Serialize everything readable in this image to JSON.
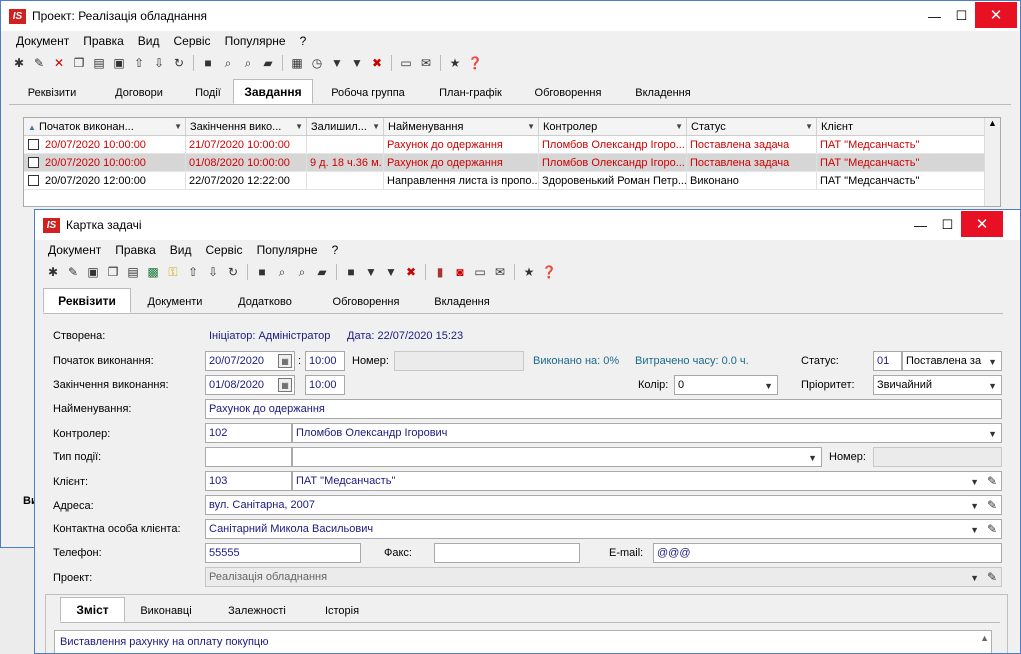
{
  "main_window": {
    "title": "Проект: Реалізація обладнання",
    "logo": "IS",
    "menu": [
      "Документ",
      "Правка",
      "Вид",
      "Сервіс",
      "Популярне",
      "?"
    ],
    "tabs": [
      "Реквізити",
      "Договори",
      "Події",
      "Завдання",
      "Робоча группа",
      "План-графік",
      "Обговорення",
      "Вкладення"
    ],
    "active_tab": "Завдання",
    "grid": {
      "columns": [
        "Початок виконан...",
        "Закінчення вико...",
        "Залишил...",
        "Найменування",
        "Контролер",
        "Статус",
        "Клієнт"
      ],
      "rows": [
        {
          "start": "20/07/2020 10:00:00",
          "end": "21/07/2020 10:00:00",
          "left": "",
          "name": "Рахунок до одержання",
          "controller": "Пломбов Олександр Ігоро...",
          "status": "Поставлена задача",
          "client": "ПАТ \"Медсанчасть\"",
          "red": true,
          "selected": false
        },
        {
          "start": "20/07/2020 10:00:00",
          "end": "01/08/2020 10:00:00",
          "left": "9 д. 18 ч.36 м.",
          "name": "Рахунок до одержання",
          "controller": "Пломбов Олександр Ігоро...",
          "status": "Поставлена задача",
          "client": "ПАТ \"Медсанчасть\"",
          "red": true,
          "selected": true
        },
        {
          "start": "20/07/2020 12:00:00",
          "end": "22/07/2020 12:22:00",
          "left": "",
          "name": "Направлення листа із пропо...",
          "controller": "Здоровенький Роман Петр...",
          "status": "Виконано",
          "client": "ПАТ \"Медсанчасть\"",
          "red": false,
          "selected": false
        }
      ]
    },
    "partial_label": "Ви"
  },
  "card": {
    "title": "Картка задачі",
    "logo": "IS",
    "menu": [
      "Документ",
      "Правка",
      "Вид",
      "Сервіс",
      "Популярне",
      "?"
    ],
    "tabs": [
      "Реквізити",
      "Документи",
      "Додатково",
      "Обговорення",
      "Вкладення"
    ],
    "active_tab": "Реквізити",
    "created_label": "Створена:",
    "initiator": "Ініціатор: Адміністратор",
    "date_text": "Дата: 22/07/2020  15:23",
    "start_label": "Початок виконання:",
    "start_date": "20/07/2020",
    "start_time": "10:00",
    "number_label": "Номер:",
    "done_text": "Виконано на: 0%",
    "spent_text": "Витрачено часу: 0.0 ч.",
    "status_label": "Статус:",
    "status_code": "01",
    "status_value": "Поставлена за",
    "end_label": "Закінчення виконання:",
    "end_date": "01/08/2020",
    "end_time": "10:00",
    "color_label": "Колір:",
    "color_value": "0",
    "priority_label": "Пріоритет:",
    "priority_value": "Звичайний",
    "name_label": "Найменування:",
    "name_value": "Рахунок до одержання",
    "controller_label": "Контролер:",
    "controller_code": "102",
    "controller_name": "Пломбов Олександр Ігорович",
    "event_label": "Тип події:",
    "event_number_label": "Номер:",
    "client_label": "Клієнт:",
    "client_code": "103",
    "client_name": "ПАТ \"Медсанчасть\"",
    "address_label": "Адреса:",
    "address_value": "вул. Санітарна, 2007",
    "contact_label": "Контактна особа клієнта:",
    "contact_value": "Санітарний Микола Васильович",
    "phone_label": "Телефон:",
    "phone_value": "55555",
    "fax_label": "Факс:",
    "email_label": "E-mail:",
    "email_value": "@@@",
    "project_label": "Проект:",
    "project_value": "Реалізація обладнання",
    "bottom_tabs": [
      "Зміст",
      "Виконавці",
      "Залежності",
      "Історія"
    ],
    "bottom_active": "Зміст",
    "content_text": "Виставлення рахунку на оплату покупцю"
  }
}
